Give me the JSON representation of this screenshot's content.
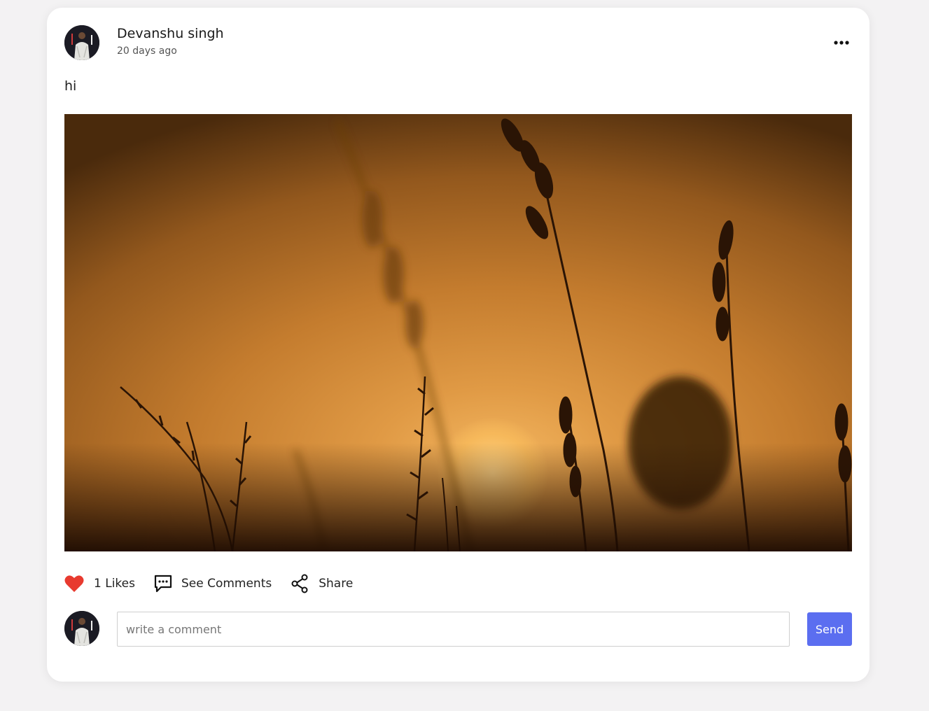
{
  "post": {
    "author": {
      "name": "Devanshu singh",
      "time": "20 days ago",
      "avatar_icon": "user-avatar"
    },
    "text": "hi",
    "image_icon": "sunset-grass-photo",
    "menu_icon": "more-horizontal-icon"
  },
  "actions": {
    "likes_label": "1 Likes",
    "like_icon": "heart-icon",
    "like_color": "#e83a2f",
    "comments_label": "See Comments",
    "comments_icon": "comment-icon",
    "share_label": "Share",
    "share_icon": "share-icon"
  },
  "comment_box": {
    "placeholder": "write a comment",
    "value": "",
    "send_label": "Send",
    "send_color": "#5b6ef0"
  },
  "colors": {
    "page_background": "#f3f2f3",
    "card_background": "#ffffff"
  }
}
